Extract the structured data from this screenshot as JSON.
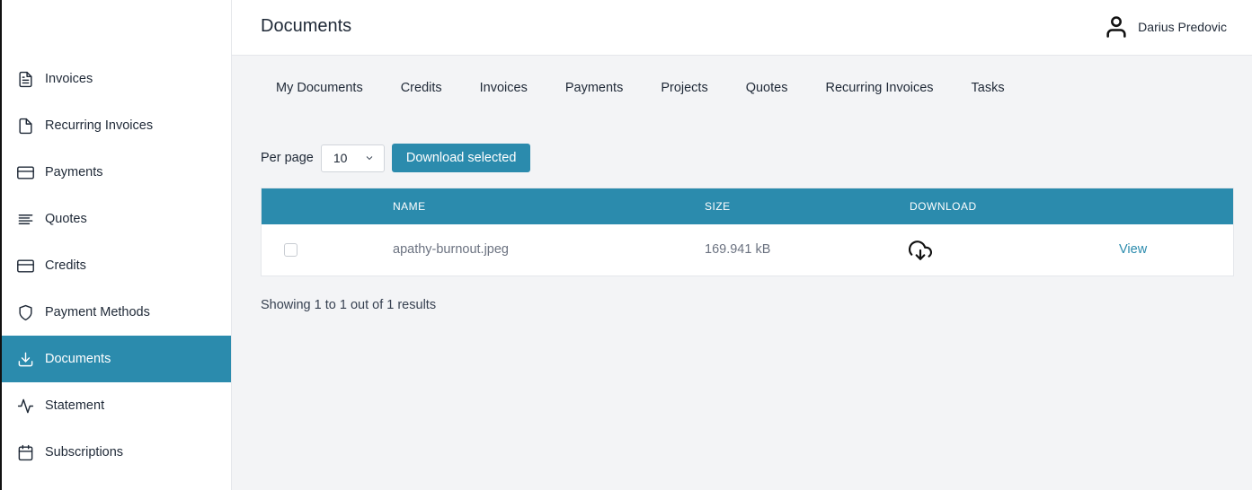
{
  "app": {
    "page_title": "Documents",
    "user_name": "Darius Predovic"
  },
  "sidebar": {
    "items": [
      {
        "label": "Invoices",
        "icon": "file-text-icon"
      },
      {
        "label": "Recurring Invoices",
        "icon": "file-icon"
      },
      {
        "label": "Payments",
        "icon": "credit-card-icon"
      },
      {
        "label": "Quotes",
        "icon": "align-left-icon"
      },
      {
        "label": "Credits",
        "icon": "credit-card-icon"
      },
      {
        "label": "Payment Methods",
        "icon": "shield-icon"
      },
      {
        "label": "Documents",
        "icon": "download-icon",
        "active": true
      },
      {
        "label": "Statement",
        "icon": "activity-icon"
      },
      {
        "label": "Subscriptions",
        "icon": "calendar-icon"
      }
    ]
  },
  "tabs": [
    "My Documents",
    "Credits",
    "Invoices",
    "Payments",
    "Projects",
    "Quotes",
    "Recurring Invoices",
    "Tasks"
  ],
  "toolbar": {
    "per_page_label": "Per page",
    "per_page_value": "10",
    "download_selected_label": "Download selected"
  },
  "table": {
    "headers": {
      "name": "NAME",
      "size": "SIZE",
      "download": "DOWNLOAD"
    },
    "rows": [
      {
        "name": "apathy-burnout.jpeg",
        "size": "169.941 kB",
        "action": "View"
      }
    ]
  },
  "pagination": {
    "summary": "Showing 1 to 1 out of 1 results"
  },
  "colors": {
    "accent": "#2b8bad",
    "background": "#f3f4f6"
  }
}
